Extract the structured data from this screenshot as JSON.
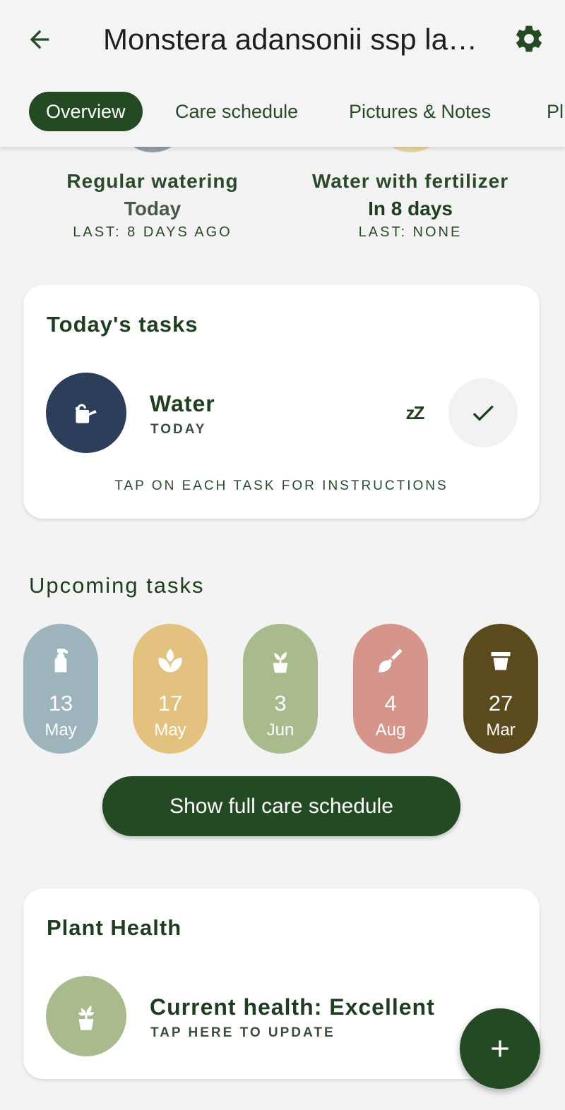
{
  "header": {
    "title": "Monstera adansonii ssp laniata",
    "icons": {
      "back": "arrow-left-icon",
      "settings": "gear-icon"
    }
  },
  "tabs": [
    {
      "label": "Overview",
      "active": true
    },
    {
      "label": "Care schedule",
      "active": false
    },
    {
      "label": "Pictures & Notes",
      "active": false
    },
    {
      "label": "Pl",
      "active": false
    }
  ],
  "summary": [
    {
      "name": "Regular watering",
      "when": "Today",
      "last": "LAST: 8 DAYS AGO",
      "color": "#9aa0a8",
      "when_color": "#4a5a4a"
    },
    {
      "name": "Water with fertilizer",
      "when": "In 8 days",
      "last": "LAST: NONE",
      "color": "#e6d7a6",
      "when_color": "#1f3d1f"
    }
  ],
  "todays_tasks": {
    "title": "Today's tasks",
    "task": {
      "name": "Water",
      "when": "TODAY",
      "icon": "watering-can-icon",
      "icon_bg": "#2c3e5a"
    },
    "snooze_icon": "snooze-icon",
    "snooze_text": "zZ",
    "complete_icon": "check-icon",
    "hint": "TAP ON EACH TASK FOR INSTRUCTIONS"
  },
  "upcoming": {
    "title": "Upcoming tasks",
    "items": [
      {
        "day": "13",
        "month": "May",
        "icon": "spray-bottle-icon",
        "color": "#9eb4bc"
      },
      {
        "day": "17",
        "month": "May",
        "icon": "fertilizer-leaf-icon",
        "color": "#e2c27e"
      },
      {
        "day": "3",
        "month": "Jun",
        "icon": "potted-plant-icon",
        "color": "#a9bb8c"
      },
      {
        "day": "4",
        "month": "Aug",
        "icon": "brush-icon",
        "color": "#d5958a"
      },
      {
        "day": "27",
        "month": "Mar",
        "icon": "pot-icon",
        "color": "#5b4a1e"
      }
    ],
    "button_label": "Show full care schedule"
  },
  "plant_health": {
    "title": "Plant Health",
    "status": "Current health: Excellent",
    "hint": "TAP HERE TO UPDATE",
    "icon": "potted-plant-icon",
    "icon_bg": "#a9bb8c"
  },
  "fab": {
    "icon": "plus-icon"
  },
  "colors": {
    "accent": "#244a24",
    "background": "#f3f3f3"
  }
}
